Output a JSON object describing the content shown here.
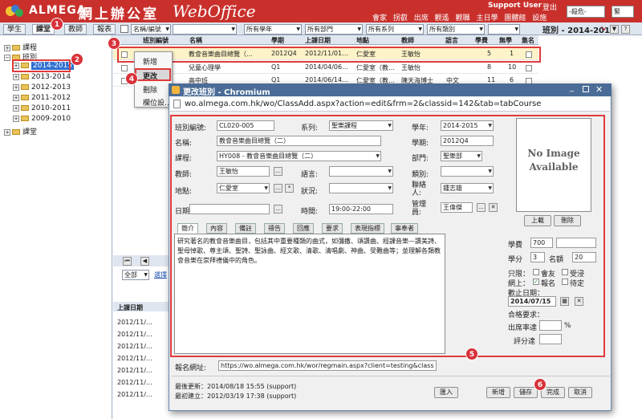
{
  "header": {
    "logo_text": "ALMEGA",
    "office_name": "網上辦公室",
    "product_name": "WebOffice",
    "user_name": "Support User",
    "logout_label": "登出",
    "links": [
      "會家",
      "拐叡",
      "出席",
      "觀遙",
      "觀職",
      "主日學",
      "團體館",
      "設施"
    ],
    "select_1": "-殺危-",
    "select_2": "緊"
  },
  "toolbar": {
    "tabs": [
      "學生",
      "課堂",
      "教師",
      "報表"
    ],
    "filters": [
      "名稱/編號",
      "所有學年",
      "所有部門",
      "所有系列",
      "所有類別"
    ],
    "class_title": "班別 - 2014-2015"
  },
  "tree": {
    "root_course": "課程",
    "root_class": "班別",
    "years": [
      "2014-2015",
      "2013-2014",
      "2012-2013",
      "2011-2012",
      "2010-2011",
      "2009-2010"
    ],
    "root_classroom": "課堂"
  },
  "grid": {
    "headers": [
      "班別編號",
      "名稱",
      "學期",
      "上課日期",
      "地點",
      "教師",
      "語言",
      "學費",
      "無學",
      "集名"
    ],
    "rows": [
      {
        "name": "教會音樂曲目總覽（…",
        "term": "2012Q4",
        "date": "2012/11/01…",
        "place": "仁愛室",
        "teacher": "王敏怡",
        "lang": "",
        "fee": "5",
        "n": "1"
      },
      {
        "name": "兒童心理學",
        "term": "Q1",
        "date": "2014/04/06…",
        "place": "仁愛室（教…",
        "teacher": "王敏怡",
        "lang": "",
        "fee": "8",
        "n": "10"
      },
      {
        "name": "高中班",
        "term": "Q1",
        "date": "2014/06/14…",
        "place": "仁愛室（教…",
        "teacher": "陳天海博士",
        "lang": "中文",
        "fee": "11",
        "n": "6"
      }
    ],
    "select_all": "全部",
    "lower_link": "選擇",
    "lower_header": "上課日期",
    "lower_dates": [
      "2012/11/…",
      "2012/11/…",
      "2012/11/…",
      "2012/11/…",
      "2012/11/…",
      "2012/11/…",
      "2012/11/…"
    ]
  },
  "context_menu": {
    "items": [
      "新增",
      "更改",
      "刪除",
      "欄位設…"
    ]
  },
  "dialog": {
    "title": "更改班別 - Chromium",
    "url": "wo.almega.com.hk/wo/ClassAdd.aspx?action=edit&frm=2&classid=142&tab=tabCourse",
    "labels": {
      "class_no": "班別編號:",
      "series": "系列:",
      "year": "學年:",
      "name": "名稱:",
      "term": "學期:",
      "course": "課程:",
      "dept": "部門:",
      "teacher": "教師:",
      "lang": "語言:",
      "category": "類別:",
      "place": "地點:",
      "status": "狀況:",
      "contact": "聯絡人:",
      "date": "日期:",
      "time": "時間:",
      "manager": "管理員:"
    },
    "values": {
      "class_no": "CL020-005",
      "series": "聖樂課程",
      "year": "2014-2015",
      "name": "教會音樂曲目總覽（二）",
      "term": "2012Q4",
      "course": "HY008 - 教會音樂曲目總覽（二）",
      "dept": "聖樂部",
      "teacher": "王敏怡",
      "lang": "",
      "category": "",
      "place": "仁愛室",
      "status": "",
      "contact": "鍾志雄",
      "date": "",
      "time": "19:00-22:00",
      "manager": "王偉傑"
    },
    "photo_text_1": "No Image",
    "photo_text_2": "Available",
    "upload_label": "上載",
    "delete_label": "刪除",
    "tabs": [
      "簡介",
      "內容",
      "備註",
      "禱告",
      "回應",
      "要求",
      "表現指標",
      "事奉者"
    ],
    "description": "研究著名的教會音樂曲目，包括其中重要種類的曲式，如彌撒、頌讚曲、經課音樂—讚美詩、聖母悼歌、尊主頌、聖詩、聖詠曲、經文歌、清歌、清唱劇、神曲、受難曲等；並理解各類教會音樂在崇拜禮儀中的角色。",
    "right": {
      "fee_label": "學費",
      "fee_value": "700",
      "credit_label": "學分",
      "credit_value": "3",
      "quota_label": "名額",
      "quota_value": "20",
      "only_label": "只限：",
      "member_label": "會友",
      "baptized_label": "受浸",
      "online_label": "網上：",
      "signup_label": "報名",
      "hold_label": "待定",
      "welcome_label": "歡止日期：",
      "welcome_value": "2014/07/15",
      "requirement_label": "合格要求：",
      "attendance_label": "出席率達",
      "percent": "%",
      "score_label": "評分達"
    },
    "signup_url_label": "報名網址:",
    "signup_url": "https://wo.almega.com.hk/wor/regmain.aspx?client=testing&class",
    "last_updated": "最後更新：2014/08/18 15:55 (support)",
    "created": "最初建立：2012/03/19 17:38 (support)",
    "buttons": {
      "import": "匯入",
      "new": "新增",
      "save": "儲存",
      "done": "完成",
      "cancel": "取消"
    }
  },
  "badges": [
    "1",
    "2",
    "3",
    "4",
    "5",
    "6"
  ],
  "colors": {
    "header": "#c9302c",
    "title_bar": "#4a6c96",
    "highlight": "#e03b3b"
  }
}
